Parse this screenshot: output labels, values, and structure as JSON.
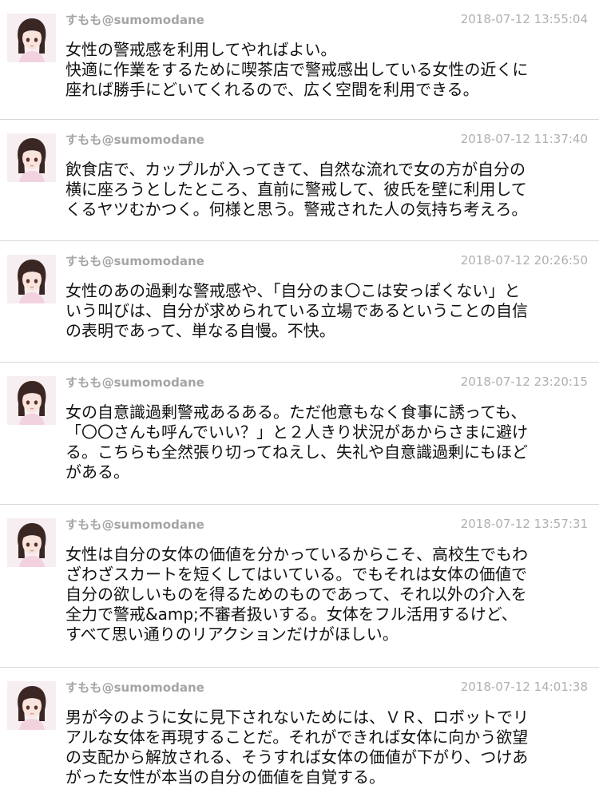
{
  "tweets": [
    {
      "name": "すもも",
      "handle": "@sumomodane",
      "time": "2018-07-12 13:55:04",
      "lines": [
        "女性の警戒感を利用してやればよい。",
        "快適に作業をするために喫茶店で警戒感出している女性の近くに",
        "座れば勝手にどいてくれるので、広く空間を利用できる。"
      ]
    },
    {
      "name": "すもも",
      "handle": "@sumomodane",
      "time": "2018-07-12 11:37:40",
      "lines": [
        "飲食店で、カップルが入ってきて、自然な流れで女の方が自分の",
        "横に座ろうとしたところ、直前に警戒して、彼氏を壁に利用して",
        "くるヤツむかつく。何様と思う。警戒された人の気持ち考えろ。"
      ]
    },
    {
      "name": "すもも",
      "handle": "@sumomodane",
      "time": "2018-07-12 20:26:50",
      "lines": [
        "女性のあの過剰な警戒感や、「自分のま〇こは安っぽくない」と",
        "いう叫びは、自分が求められている立場であるということの自信",
        "の表明であって、単なる自慢。不快。"
      ]
    },
    {
      "name": "すもも",
      "handle": "@sumomodane",
      "time": "2018-07-12 23:20:15",
      "lines": [
        "女の自意識過剰警戒あるある。ただ他意もなく食事に誘っても、",
        "「〇〇さんも呼んでいい？」と２人きり状況があからさまに避け",
        "る。こちらも全然張り切ってねえし、失礼や自意識過剰にもほど",
        "がある。"
      ]
    },
    {
      "name": "すもも",
      "handle": "@sumomodane",
      "time": "2018-07-12 13:57:31",
      "lines": [
        "女性は自分の女体の価値を分かっているからこそ、高校生でもわ",
        "ざわざスカートを短くしてはいている。でもそれは女体の価値で",
        "自分の欲しいものを得るためのものであって、それ以外の介入を",
        "全力で警戒&amp;不審者扱いする。女体をフル活用するけど、",
        "すべて思い通りのリアクションだけがほしい。"
      ]
    },
    {
      "name": "すもも",
      "handle": "@sumomodane",
      "time": "2018-07-12 14:01:38",
      "lines": [
        "男が今のように女に見下されないためには、ＶＲ、ロボットでリ",
        "アルな女体を再現することだ。それができれば女体に向かう欲望",
        "の支配から解放される、そうすれば女体の価値が下がり、つけあ",
        "がった女性が本当の自分の価値を自覚する。"
      ]
    }
  ]
}
